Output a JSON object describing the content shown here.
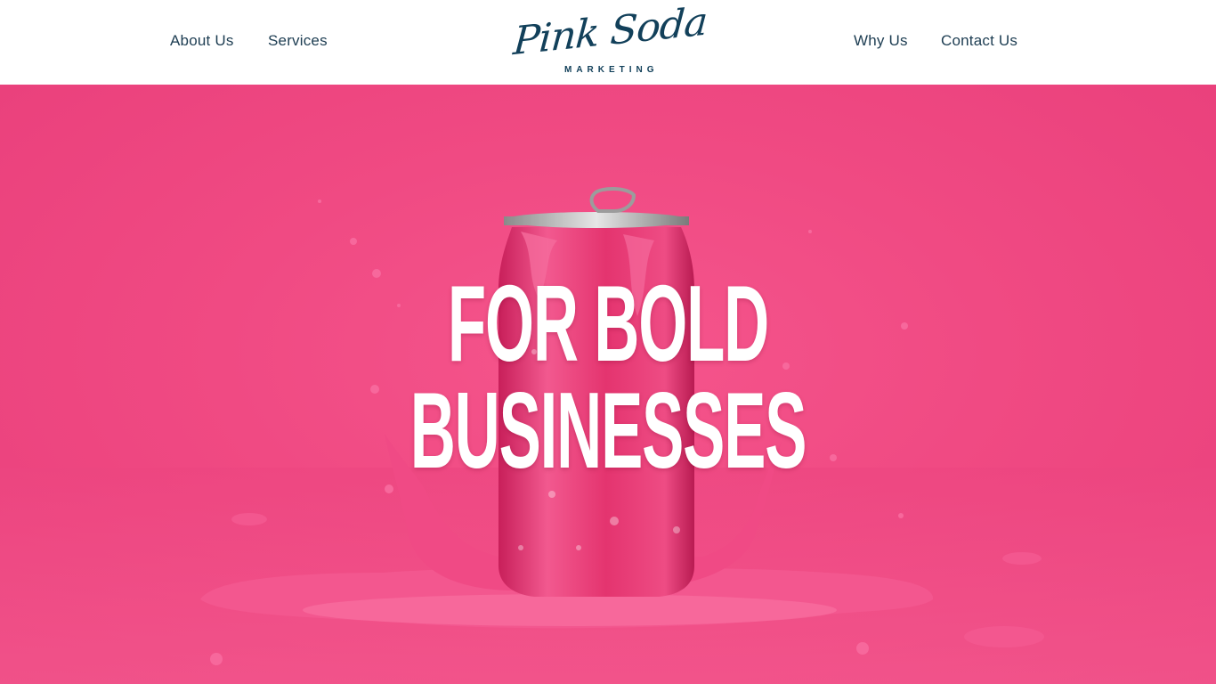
{
  "nav": {
    "left": [
      {
        "label": "About Us"
      },
      {
        "label": "Services"
      }
    ],
    "right": [
      {
        "label": "Why Us"
      },
      {
        "label": "Contact Us"
      }
    ]
  },
  "logo": {
    "script": "Pink Soda",
    "subtitle": "MARKETING"
  },
  "hero": {
    "line1": "FOR BOLD",
    "line2": "BUSINESSES",
    "image": "pink-soda-can-splash"
  },
  "colors": {
    "nav_text": "#1d3d52",
    "logo": "#12405a",
    "hero_pink": "#f04a83",
    "can_pink": "#e9336f",
    "headline": "#ffffff"
  }
}
